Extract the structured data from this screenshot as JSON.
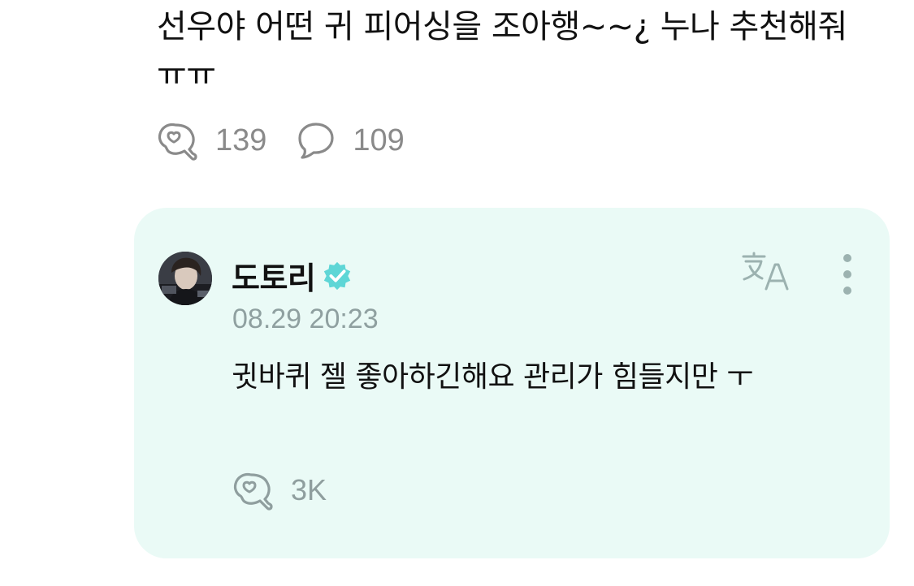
{
  "post": {
    "text": "선우야 어떤 귀 피어싱을 조아행~~¿ 누나 추천해줘 ㅠㅠ",
    "reaction_count": "139",
    "comment_count": "109",
    "icons": {
      "reaction": "heart-sticker-icon",
      "comment": "speech-bubble-icon"
    }
  },
  "reply": {
    "author": "도토리",
    "timestamp": "08.29 20:23",
    "text": "귓바퀴 젤 좋아하긴해요 관리가 힘들지만 ㅜ",
    "reaction_count": "3K",
    "icons": {
      "verified": "verified-badge-icon",
      "translate": "translate-icon",
      "more": "more-vertical-icon",
      "reaction": "heart-sticker-icon"
    }
  },
  "colors": {
    "card_background": "#eafaf6",
    "verified_badge": "#5ed6d6",
    "muted_text": "#8a8a8a",
    "reply_muted_text": "#8f9e9e"
  }
}
